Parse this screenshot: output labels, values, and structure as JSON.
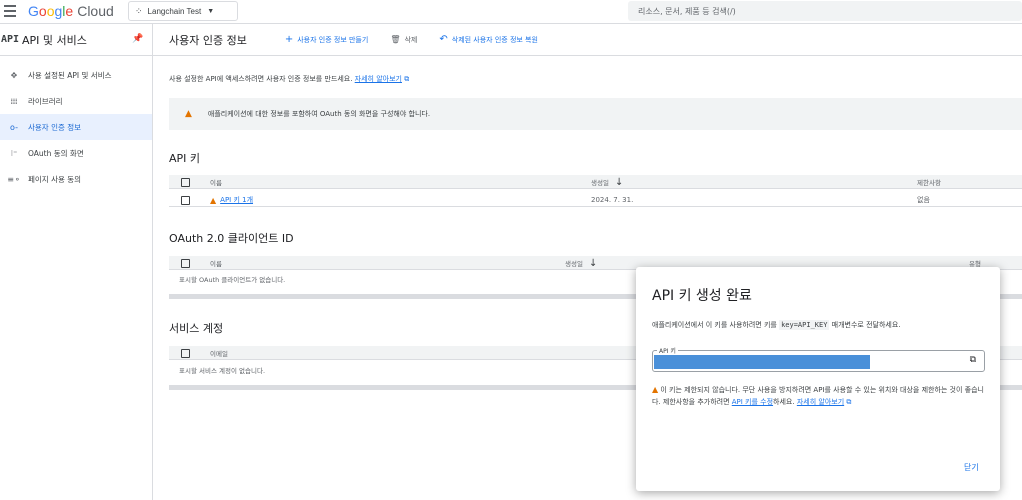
{
  "topbar": {
    "logo_google": "Google",
    "logo_cloud": "Cloud",
    "project": "Langchain Test",
    "search_placeholder": "리소스, 문서, 제품 등 검색(/)"
  },
  "sidebar": {
    "mark": "API",
    "title": "API 및 서비스",
    "items": [
      {
        "label": "사용 설정된 API 및 서비스",
        "icon": "api-hub-icon"
      },
      {
        "label": "라이브러리",
        "icon": "library-icon"
      },
      {
        "label": "사용자 인증 정보",
        "icon": "key-icon"
      },
      {
        "label": "OAuth 동의 화면",
        "icon": "consent-icon"
      },
      {
        "label": "페이지 사용 동의",
        "icon": "settings-list-icon"
      }
    ]
  },
  "main": {
    "title": "사용자 인증 정보",
    "actions": {
      "create": "사용자 인증 정보 만들기",
      "delete": "삭제",
      "restore": "삭제된 사용자 인증 정보 복원"
    },
    "description": "사용 설정한 API에 액세스하려면 사용자 인증 정보를 만드세요.",
    "learn_more": "자세히 알아보기",
    "warning": "애플리케이션에 대한 정보를 포함하여 OAuth 동의 화면을 구성해야 합니다.",
    "api_keys": {
      "title": "API 키",
      "headers": {
        "name": "이름",
        "created": "생성일",
        "restrictions": "제한사항"
      },
      "rows": [
        {
          "name": "API 키 1개",
          "created": "2024. 7. 31.",
          "restrictions": "없음"
        }
      ]
    },
    "oauth": {
      "title": "OAuth 2.0 클라이언트 ID",
      "headers": {
        "name": "이름",
        "created": "생성일",
        "type": "유형"
      },
      "empty": "표시할 OAuth 클라이언트가 없습니다."
    },
    "service_accounts": {
      "title": "서비스 계정",
      "headers": {
        "email": "이메일"
      },
      "empty": "표시할 서비스 계정이 없습니다."
    }
  },
  "modal": {
    "title": "API 키 생성 완료",
    "desc_before": "애플리케이션에서 이 키를 사용하려면 키를",
    "desc_code": "key=API_KEY",
    "desc_after": "매개변수로 전달하세요.",
    "field_label": "API 키",
    "warning_text": "이 키는 제한되지 않습니다. 무단 사용을 방지하려면 API를 사용할 수 있는 위치와 대상을 제한하는 것이 좋습니다. 제한사항을 추가하려면",
    "edit_link": "API 키를 수정",
    "warning_mid": "하세요.",
    "learn_more": "자세히 알아보기",
    "close": "닫기"
  },
  "colors": {
    "accent": "#1a73e8",
    "warning": "#e37400",
    "key_highlight": "#4a90d9"
  }
}
